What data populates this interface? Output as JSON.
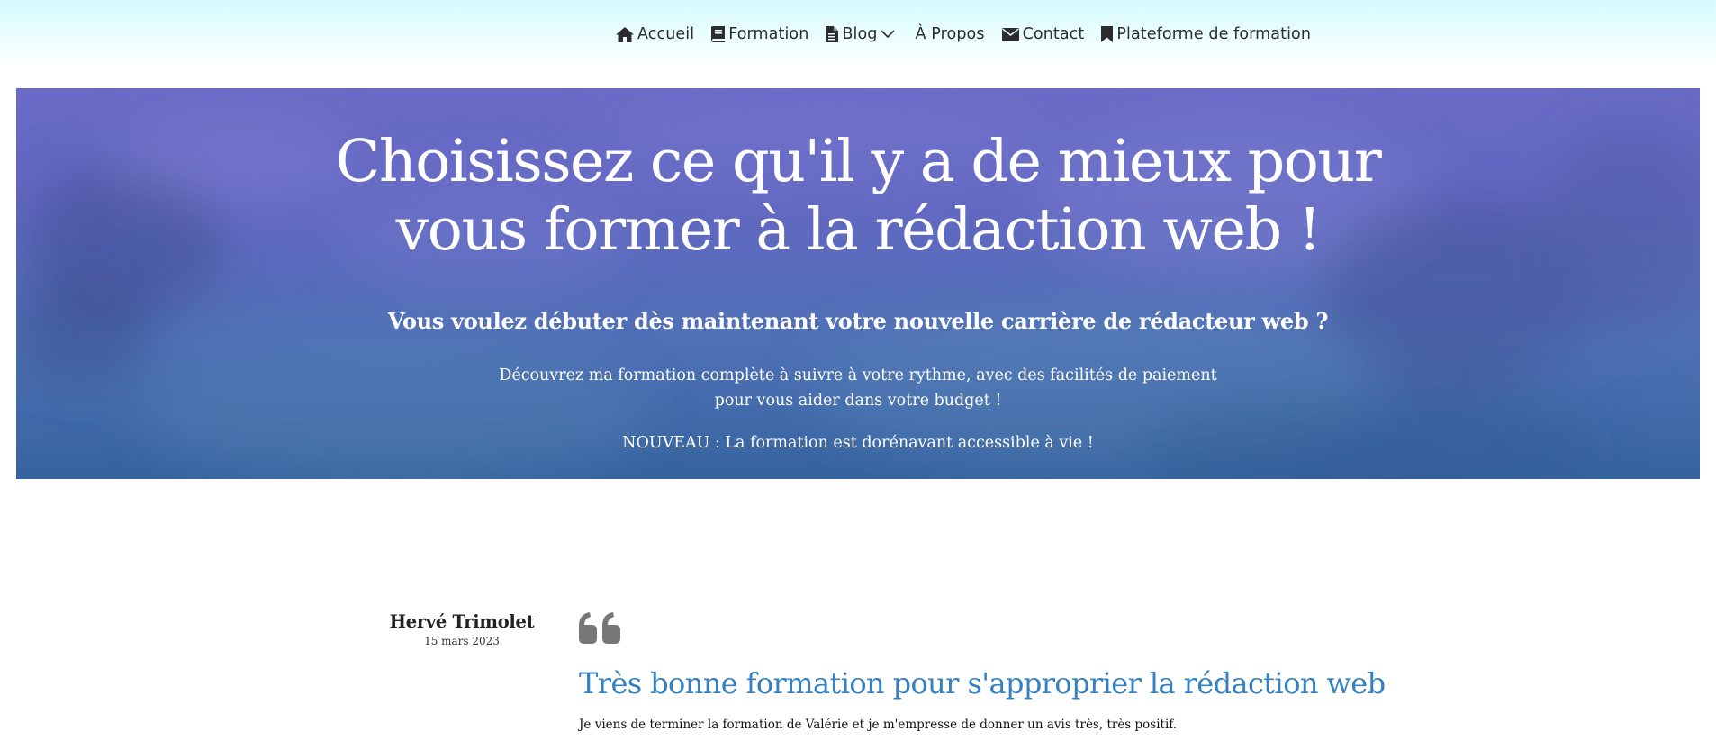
{
  "nav": {
    "items": [
      {
        "label": "Accueil",
        "icon": "home-icon"
      },
      {
        "label": "Formation",
        "icon": "book-icon"
      },
      {
        "label": "Blog",
        "icon": "file-icon",
        "dropdown": true
      },
      {
        "label": "À Propos"
      },
      {
        "label": "Contact",
        "icon": "envelope-icon"
      },
      {
        "label": "Plateforme de formation",
        "icon": "bookmark-icon"
      }
    ]
  },
  "hero": {
    "title_line1": "Choisissez ce qu'il y a de mieux pour",
    "title_line2": "vous former à la rédaction web !",
    "subtitle": "Vous voulez débuter dès maintenant votre nouvelle carrière de rédacteur web ?",
    "desc_line1": "Découvrez ma formation complète à suivre à votre rythme, avec des facilités de paiement",
    "desc_line2": "pour vous aider dans votre budget !",
    "new_notice": "NOUVEAU : La formation est dorénavant accessible à vie !"
  },
  "testimonial": {
    "author": "Hervé Trimolet",
    "date": "15 mars 2023",
    "title": "Très bonne formation pour s'approprier la rédaction web",
    "text": "Je viens de terminer la formation de Valérie et je m'empresse de donner un avis très, très positif."
  },
  "colors": {
    "nav_text": "#2c2c2c",
    "hero_top": "#6a6bc6",
    "hero_bottom": "#36649f",
    "review_title": "#3580c1",
    "quote_icon": "#777777"
  }
}
